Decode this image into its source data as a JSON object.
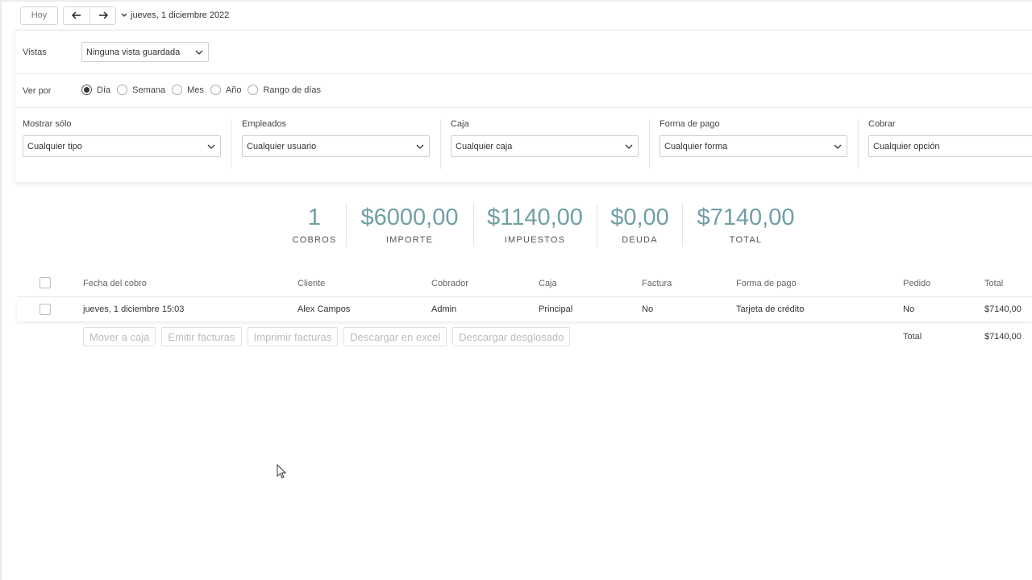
{
  "toolbar": {
    "today_label": "Hoy",
    "date_label": "jueves, 1 diciembre 2022"
  },
  "filters": {
    "views_label": "Vistas",
    "views_value": "Ninguna vista guardada",
    "view_by_label": "Ver por",
    "view_by_options": [
      {
        "label": "Día",
        "selected": true
      },
      {
        "label": "Semana",
        "selected": false
      },
      {
        "label": "Mes",
        "selected": false
      },
      {
        "label": "Año",
        "selected": false
      },
      {
        "label": "Rango de días",
        "selected": false
      }
    ],
    "show_only": {
      "label": "Mostrar sólo",
      "value": "Cualquier tipo"
    },
    "employees": {
      "label": "Empleados",
      "value": "Cualquier usuario"
    },
    "cash": {
      "label": "Caja",
      "value": "Cualquier caja"
    },
    "payment": {
      "label": "Forma de pago",
      "value": "Cualquier forma"
    },
    "charge": {
      "label": "Cobrar",
      "value": "Cualquier opción"
    }
  },
  "stats": [
    {
      "value": "1",
      "caption": "COBROS"
    },
    {
      "value": "$6000,00",
      "caption": "IMPORTE"
    },
    {
      "value": "$1140,00",
      "caption": "IMPUESTOS"
    },
    {
      "value": "$0,00",
      "caption": "DEUDA"
    },
    {
      "value": "$7140,00",
      "caption": "TOTAL"
    }
  ],
  "colors": {
    "accent": "#6f9fa5"
  },
  "table": {
    "headers": [
      "Fecha del cobro",
      "Cliente",
      "Cobrador",
      "Caja",
      "Factura",
      "Forma de pago",
      "Pedido",
      "Total"
    ],
    "rows": [
      [
        "jueves, 1 diciembre 15:03",
        "Alex Campos",
        "Admin",
        "Principal",
        "No",
        "Tarjeta de crédito",
        "No",
        "$7140,00"
      ]
    ],
    "total_label": "Total",
    "total_value": "$7140,00"
  },
  "actions": [
    "Mover a caja",
    "Emitir facturas",
    "Imprimir facturas",
    "Descargar en excel",
    "Descargar desglosado"
  ]
}
